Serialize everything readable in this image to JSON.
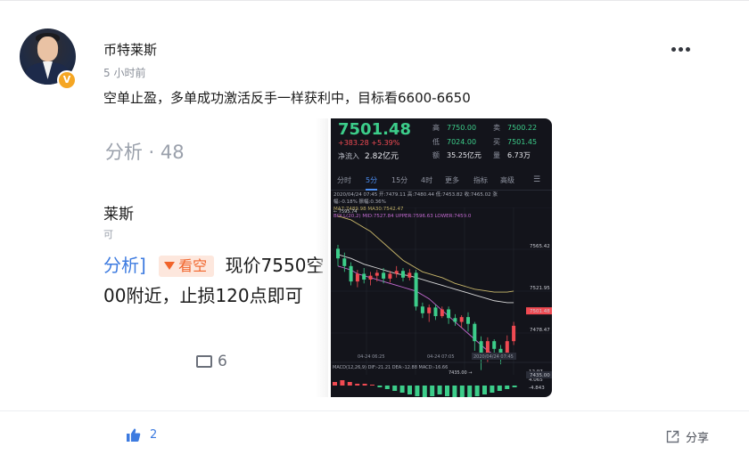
{
  "post": {
    "author": "币特莱斯",
    "time": "5 小时前",
    "content": "空单止盈，多单成功激活反手一样获利中，目标看6600-6650",
    "verified_badge": "V",
    "more_icon": "more-horizontal-icon"
  },
  "image1": {
    "title": "l分析 · 48",
    "author": "莱斯",
    "sub": "可",
    "tag": "看空",
    "line1_prefix": "分析]",
    "line1_suffix": "现价7550空",
    "line2": "00附近，止损120点即可",
    "comments": "6"
  },
  "image2": {
    "price": "7501.48",
    "change": "+383.28   +5.39%",
    "inflow_label": "净流入",
    "inflow_value": "2.82亿元",
    "high_label": "高",
    "high_value": "7750.00",
    "low_label": "低",
    "low_value": "7024.00",
    "amount_label": "额",
    "amount_value": "35.25亿元",
    "sell_label": "卖",
    "sell_value": "7500.22",
    "buy_label": "买",
    "buy_value": "7501.45",
    "vol_label": "量",
    "vol_value": "6.73万",
    "tabs": [
      "分时",
      "5分",
      "15分",
      "4时",
      "更多",
      "指标",
      "高级"
    ],
    "ind_line1": "2020/04/24 07:45  开:7479.11  高:7480.44  低:7453.82  收:7465.02  涨",
    "ind_line2": "幅:-0.18%  振幅:0.36%",
    "ind_line3": "MA7:7489.98  MA30:7542.47",
    "ind_line4": "BOLL(20,2)  MID:7527.84  UPPER:7596.63  LOWER:7459.0",
    "macd_label": "MACD(12,26,9)  DIF:-21.21  DEA:-12.88  MACD:-16.66",
    "price_labels": [
      "7608.90",
      "7565.42",
      "7521.95",
      "7501.48",
      "7478.47",
      "7435.00"
    ],
    "top_marker": "7595.74",
    "low_marker": "7435.00",
    "time_labels": [
      "04-24 06:25",
      "04-24 07:05",
      "2020/04/24 07:45"
    ],
    "macd_labels": [
      "12.97",
      "4.065",
      "-4.843"
    ]
  },
  "footer": {
    "likes": "2",
    "share": "分享",
    "like_icon": "thumbs-up-icon",
    "share_icon": "share-icon"
  }
}
